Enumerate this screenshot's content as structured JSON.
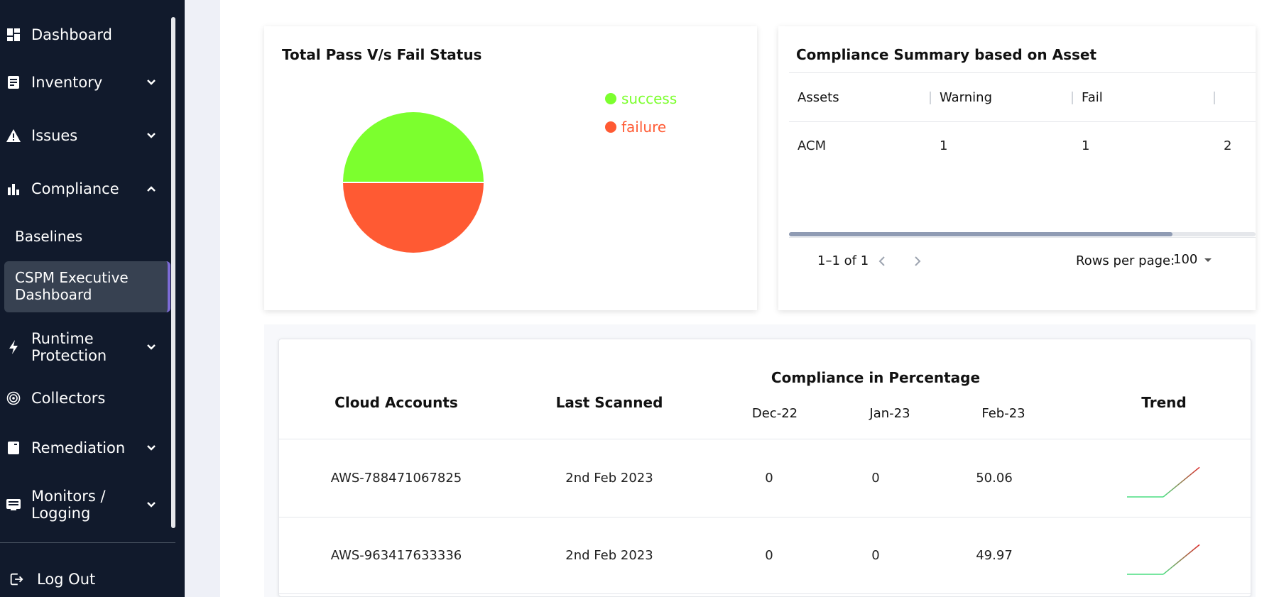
{
  "sidebar": {
    "items": [
      {
        "label": "Dashboard",
        "icon": "dashboard-icon"
      },
      {
        "label": "Inventory",
        "icon": "inventory-icon"
      },
      {
        "label": "Issues",
        "icon": "warning-icon"
      },
      {
        "label": "Compliance",
        "icon": "bar-chart-icon"
      },
      {
        "label": "Runtime Protection",
        "icon": "bolt-icon"
      },
      {
        "label": "Collectors",
        "icon": "target-icon"
      },
      {
        "label": "Remediation",
        "icon": "remediation-icon"
      },
      {
        "label": "Monitors / Logging",
        "icon": "monitor-icon"
      }
    ],
    "compliance_sub": [
      {
        "label": "Baselines"
      },
      {
        "label": "CSPM Executive Dashboard"
      }
    ],
    "logout_label": "Log Out"
  },
  "pie_card": {
    "title": "Total Pass V/s Fail Status",
    "legend": [
      {
        "label": "success",
        "color": "#7cff2e"
      },
      {
        "label": "failure",
        "color": "#ff5a33"
      }
    ]
  },
  "chart_data": {
    "type": "pie",
    "title": "Total Pass V/s Fail Status",
    "categories": [
      "success",
      "failure"
    ],
    "values": [
      50,
      50
    ],
    "colors": [
      "#7cff2e",
      "#ff5a33"
    ],
    "legend_position": "top-right"
  },
  "summary_card": {
    "title": "Compliance Summary based on Asset",
    "columns": [
      "Assets",
      "Warning",
      "Fail",
      ""
    ],
    "rows": [
      [
        "ACM",
        "1",
        "1",
        "2"
      ]
    ],
    "pagination": {
      "range": "1–1 of 1",
      "rows_per_page_label": "Rows per page:",
      "rows_per_page": "100"
    }
  },
  "accounts_table": {
    "headers": {
      "cloud_accounts": "Cloud Accounts",
      "last_scanned": "Last Scanned",
      "compliance": "Compliance in Percentage",
      "trend": "Trend"
    },
    "months": [
      "Dec-22",
      "Jan-23",
      "Feb-23"
    ],
    "rows": [
      {
        "account": "AWS-788471067825",
        "scanned": "2nd Feb 2023",
        "dec": "0",
        "jan": "0",
        "feb": "50.06",
        "trend": [
          0,
          0,
          50.06
        ]
      },
      {
        "account": "AWS-963417633336",
        "scanned": "2nd Feb 2023",
        "dec": "0",
        "jan": "0",
        "feb": "49.97",
        "trend": [
          0,
          0,
          49.97
        ]
      }
    ]
  },
  "colors": {
    "sidebar_bg": "#111a2c",
    "active_accent": "#7c6bd6",
    "trend_low": "#4ade80",
    "trend_high": "#dc2626"
  }
}
